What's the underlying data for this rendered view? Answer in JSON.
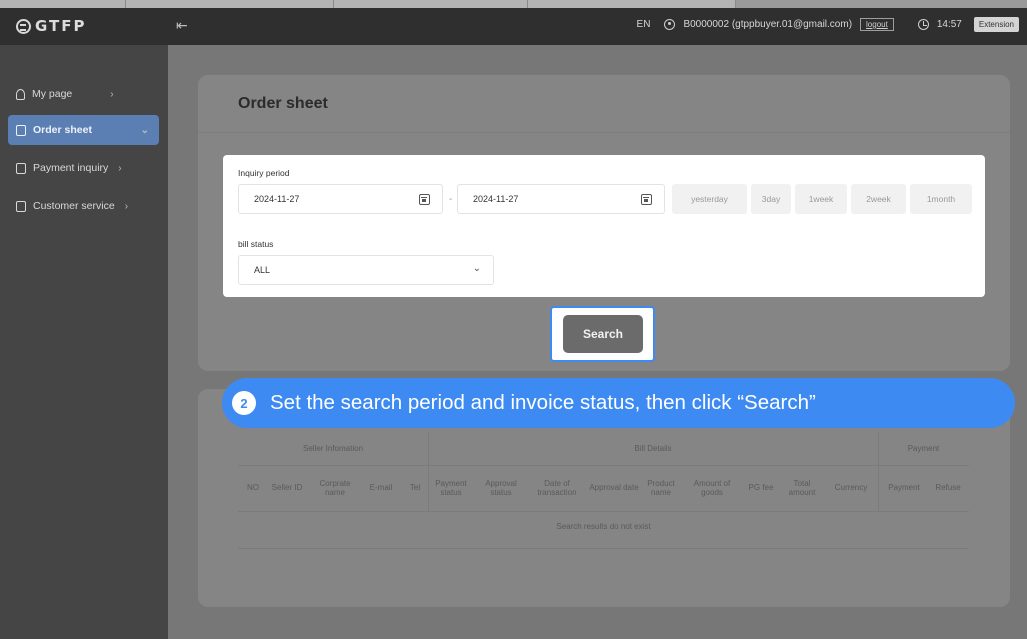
{
  "header": {
    "logo_text": "GTFP",
    "lang": "EN",
    "user": "B0000002 (gtppbuyer.01@gmail.com)",
    "logout": "logout",
    "time": "14:57",
    "extension": "Extension"
  },
  "sidebar": {
    "items": [
      {
        "label": "My page",
        "icon": "person-icon"
      },
      {
        "label": "Order sheet",
        "icon": "document-icon"
      },
      {
        "label": "Payment inquiry",
        "icon": "clipboard-icon"
      },
      {
        "label": "Customer service",
        "icon": "grid-icon"
      }
    ]
  },
  "main": {
    "title": "Order sheet",
    "filter": {
      "period_label": "Inquiry period",
      "start_date": "2024-11-27",
      "end_date": "2024-11-27",
      "dash": "-",
      "quick_ranges": [
        "yesterday",
        "3day",
        "1week",
        "2week",
        "1month"
      ],
      "status_label": "bill status",
      "status_value": "ALL"
    },
    "search_label": "Search"
  },
  "banner": {
    "step": "2",
    "text": "Set the search period and invoice status, then click “Search”"
  },
  "table": {
    "groups": [
      "Seller Infomation",
      "Bill Details",
      "Payment"
    ],
    "columns": [
      "NO",
      "Seller ID",
      "Corprate name",
      "E-mail",
      "Tel",
      "Payment status",
      "Approval status",
      "Date of transaction",
      "Approval date",
      "Product name",
      "Amount of goods",
      "PG fee",
      "Total amount",
      "Currency",
      "Payment",
      "Refuse"
    ],
    "empty_message": "Search results do not exist"
  },
  "colors": {
    "accent": "#3d8bf2",
    "sidebar_active": "#5b7fb3"
  }
}
